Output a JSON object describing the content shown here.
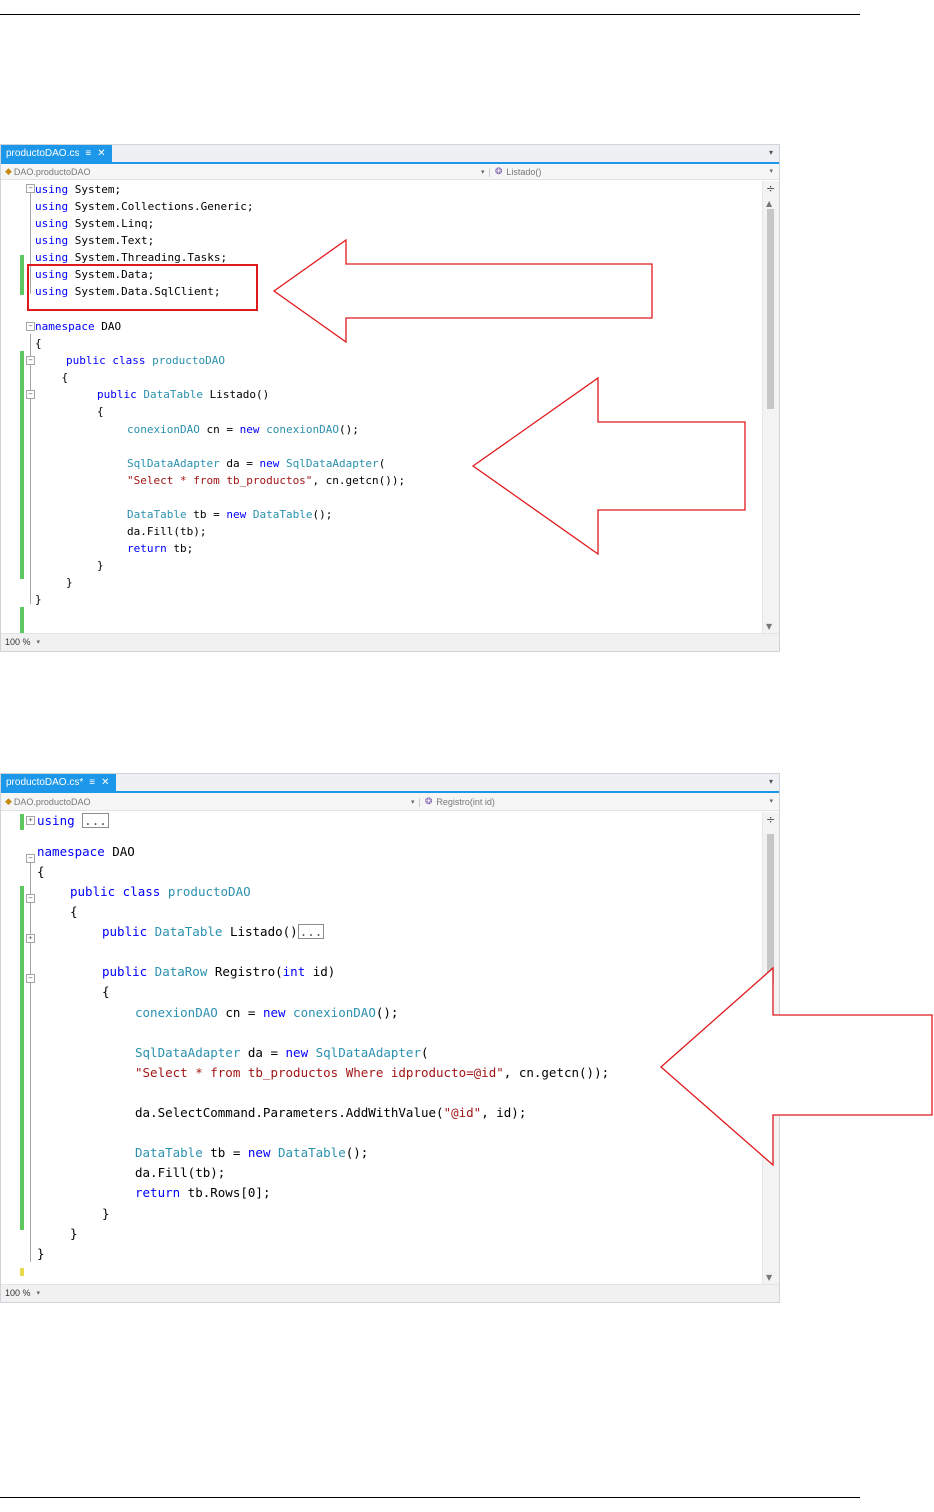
{
  "editor1": {
    "tab_label": "productoDAO.cs",
    "tab_pin": "≡",
    "tab_close": "✕",
    "nav_left": "DAO.productoDAO",
    "nav_right": "Listado()",
    "zoom": "100 %",
    "lines": {
      "l1": {
        "fold": "−",
        "kw": "using",
        "rest": " System;"
      },
      "l2": {
        "kw": "using",
        "rest": " System.Collections.Generic;"
      },
      "l3": {
        "kw": "using",
        "rest": " System.Linq;"
      },
      "l4": {
        "kw": "using",
        "rest": " System.Text;"
      },
      "l5": {
        "kw": "using",
        "rest": " System.Threading.Tasks;"
      },
      "l6": {
        "kw": "using",
        "rest": " System.Data;"
      },
      "l7": {
        "kw": "using",
        "rest": " System.Data.SqlClient;"
      },
      "l8": {
        "kw": "namespace",
        "rest": " DAO"
      },
      "l9": {
        "text": "{"
      },
      "l10": {
        "kw": "public",
        "kw2": " class",
        "ty": " productoDAO"
      },
      "l11": {
        "text": "    {"
      },
      "l12": {
        "kw": "public",
        "ty": " DataTable",
        "rest": " Listado()"
      },
      "l13": {
        "text": "{"
      },
      "l14": {
        "ty": "conexionDAO",
        "rest": " cn = ",
        "kw": "new",
        "ty2": " conexionDAO",
        "rest2": "();"
      },
      "l15": {
        "ty": "SqlDataAdapter",
        "rest": " da = ",
        "kw": "new",
        "ty2": " SqlDataAdapter",
        "rest2": "("
      },
      "l16": {
        "st": "\"Select * from tb_productos\"",
        "rest": ", cn.getcn());"
      },
      "l17": {
        "ty": "DataTable",
        "rest": " tb = ",
        "kw": "new",
        "ty2": " DataTable",
        "rest2": "();"
      },
      "l18": {
        "text": "da.Fill(tb);"
      },
      "l19": {
        "kw": "return",
        "rest": " tb;"
      },
      "l20": {
        "text": "}"
      },
      "l21": {
        "text": "}"
      },
      "l22": {
        "text": "}"
      }
    }
  },
  "editor2": {
    "tab_label": "productoDAO.cs*",
    "tab_pin": "≡",
    "tab_close": "✕",
    "nav_left": "DAO.productoDAO",
    "nav_right": "Registro(int id)",
    "zoom": "100 %",
    "collapsed_marker": "...",
    "lines": {
      "l1": {
        "kw": "using"
      },
      "l2": {
        "kw": "namespace",
        "rest": " DAO"
      },
      "l3": {
        "text": "{"
      },
      "l4": {
        "kw": "public",
        "kw2": " class",
        "ty": " productoDAO"
      },
      "l5": {
        "text": "{"
      },
      "l6": {
        "kw": "public",
        "ty": " DataTable",
        "rest": " Listado()"
      },
      "l7": {
        "kw": "public",
        "ty": " DataRow",
        "rest": " Registro(",
        "kw2": "int",
        "rest2": " id)"
      },
      "l8": {
        "text": "{"
      },
      "l9": {
        "ty": "conexionDAO",
        "rest": " cn = ",
        "kw": "new",
        "ty2": " conexionDAO",
        "rest2": "();"
      },
      "l10": {
        "ty": "SqlDataAdapter",
        "rest": " da = ",
        "kw": "new",
        "ty2": " SqlDataAdapter",
        "rest2": "("
      },
      "l11": {
        "st": "\"Select * from tb_productos Where idproducto=@id\"",
        "rest": ", cn.getcn());"
      },
      "l12": {
        "rest": "da.SelectCommand.Parameters.AddWithValue(",
        "st": "\"@id\"",
        "rest2": ", id);"
      },
      "l13": {
        "ty": "DataTable",
        "rest": " tb = ",
        "kw": "new",
        "ty2": " DataTable",
        "rest2": "();"
      },
      "l14": {
        "text": "da.Fill(tb);"
      },
      "l15": {
        "kw": "return",
        "rest": " tb.Rows[0];"
      },
      "l16": {
        "text": "}"
      },
      "l17": {
        "text": "}"
      },
      "l18": {
        "text": "}"
      }
    }
  },
  "colors": {
    "keyword": "#0000ff",
    "type": "#2b91af",
    "string": "#a31515",
    "tab_active": "#1c97ea",
    "change_bar": "#5fc75f",
    "annotation": "#e0191d"
  },
  "icons": {
    "class_icon": "class-icon",
    "method_icon": "method-icon",
    "split_icon": "split-icon"
  }
}
